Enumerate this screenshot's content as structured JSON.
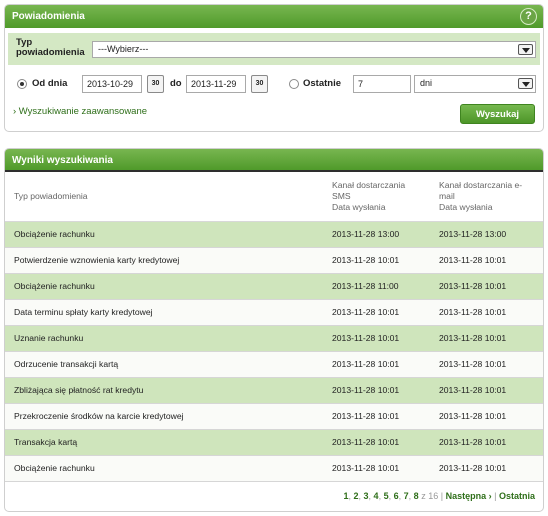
{
  "search_panel": {
    "title": "Powiadomienia",
    "help_icon": "?",
    "type_label_line1": "Typ",
    "type_label_line2": "powiadomienia",
    "type_select_value": "---Wybierz---",
    "from_label": "Od dnia",
    "date_from": "2013-10-29",
    "calendar_label": "30",
    "to_label": "do",
    "date_to": "2013-11-29",
    "last_label": "Ostatnie",
    "last_value": "7",
    "unit_select_value": "dni",
    "advanced_link": "› Wyszukiwanie zaawansowane",
    "search_button": "Wyszukaj"
  },
  "results_panel": {
    "title": "Wyniki wyszukiwania",
    "columns": {
      "type": "Typ powiadomienia",
      "sms_line1": "Kanał dostarczania",
      "sms_line2": "SMS",
      "sms_line3": "Data wysłania",
      "email_line1": "Kanał dostarczania e-",
      "email_line2": "mail",
      "email_line3": "Data wysłania"
    },
    "rows": [
      {
        "type": "Obciążenie rachunku",
        "sms": "2013-11-28 13:00",
        "email": "2013-11-28 13:00"
      },
      {
        "type": "Potwierdzenie wznowienia karty kredytowej",
        "sms": "2013-11-28 10:01",
        "email": "2013-11-28 10:01"
      },
      {
        "type": "Obciążenie rachunku",
        "sms": "2013-11-28 11:00",
        "email": "2013-11-28 10:01"
      },
      {
        "type": "Data terminu spłaty karty kredytowej",
        "sms": "2013-11-28 10:01",
        "email": "2013-11-28 10:01"
      },
      {
        "type": "Uznanie rachunku",
        "sms": "2013-11-28 10:01",
        "email": "2013-11-28 10:01"
      },
      {
        "type": "Odrzucenie transakcji kartą",
        "sms": "2013-11-28 10:01",
        "email": "2013-11-28 10:01"
      },
      {
        "type": "Zbliżająca się płatność rat kredytu",
        "sms": "2013-11-28 10:01",
        "email": "2013-11-28 10:01"
      },
      {
        "type": "Przekroczenie środków na karcie kredytowej",
        "sms": "2013-11-28 10:01",
        "email": "2013-11-28 10:01"
      },
      {
        "type": "Transakcja kartą",
        "sms": "2013-11-28 10:01",
        "email": "2013-11-28 10:01"
      },
      {
        "type": "Obciążenie rachunku",
        "sms": "2013-11-28 10:01",
        "email": "2013-11-28 10:01"
      }
    ],
    "pagination": {
      "pages": [
        "1",
        "2",
        "3",
        "4",
        "5",
        "6",
        "7",
        "8"
      ],
      "of_text": "z 16",
      "next": "Następna ›",
      "last": "Ostatnia"
    }
  },
  "colors": {
    "accent_green": "#5aa234",
    "row_green": "#cfe5bc"
  }
}
